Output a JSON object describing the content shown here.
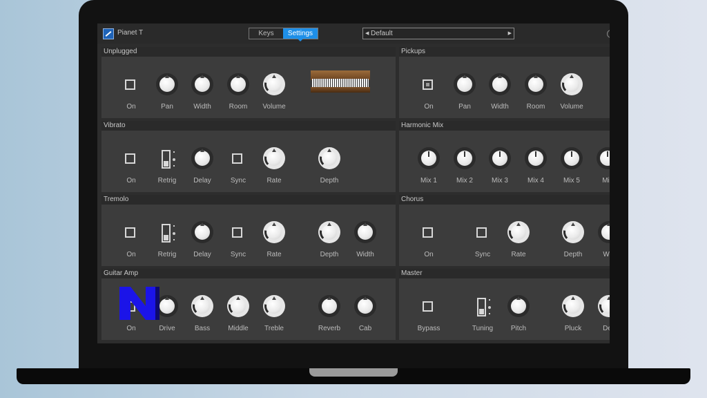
{
  "app": {
    "title": "Pianet T"
  },
  "tabs": [
    {
      "label": "Keys"
    },
    {
      "label": "Settings"
    }
  ],
  "preset": {
    "name": "Default"
  },
  "colors": {
    "accent": "#1e8fe8",
    "panel_bg": "#3c3c3c",
    "overlay_logo": "#1b14e8"
  },
  "panels": {
    "unplugged": {
      "title": "Unplugged",
      "controls": [
        {
          "type": "checkbox",
          "label": "On",
          "checked": false
        },
        {
          "type": "knob",
          "label": "Pan"
        },
        {
          "type": "knob",
          "label": "Width"
        },
        {
          "type": "knob",
          "label": "Room"
        },
        {
          "type": "knob",
          "label": "Volume"
        }
      ],
      "image": "piano-image"
    },
    "pickups": {
      "title": "Pickups",
      "controls": [
        {
          "type": "checkbox",
          "label": "On",
          "checked": true
        },
        {
          "type": "knob",
          "label": "Pan"
        },
        {
          "type": "knob",
          "label": "Width"
        },
        {
          "type": "knob",
          "label": "Room"
        },
        {
          "type": "knob",
          "label": "Volume"
        }
      ]
    },
    "vibrato": {
      "title": "Vibrato",
      "controls": [
        {
          "type": "checkbox",
          "label": "On",
          "checked": false
        },
        {
          "type": "toggle",
          "label": "Retrig"
        },
        {
          "type": "knob",
          "label": "Delay"
        },
        {
          "type": "checkbox",
          "label": "Sync",
          "checked": false
        },
        {
          "type": "knob",
          "label": "Rate"
        },
        {
          "type": "knob",
          "label": "Depth"
        }
      ]
    },
    "harmonic_mix": {
      "title": "Harmonic Mix",
      "controls": [
        {
          "type": "knob",
          "label": "Mix 1"
        },
        {
          "type": "knob",
          "label": "Mix 2"
        },
        {
          "type": "knob",
          "label": "Mix 3"
        },
        {
          "type": "knob",
          "label": "Mix 4"
        },
        {
          "type": "knob",
          "label": "Mix 5"
        },
        {
          "type": "knob",
          "label": "Mix"
        }
      ]
    },
    "tremolo": {
      "title": "Tremolo",
      "controls": [
        {
          "type": "checkbox",
          "label": "On",
          "checked": false
        },
        {
          "type": "toggle",
          "label": "Retrig"
        },
        {
          "type": "knob",
          "label": "Delay"
        },
        {
          "type": "checkbox",
          "label": "Sync",
          "checked": false
        },
        {
          "type": "knob",
          "label": "Rate"
        },
        {
          "type": "knob",
          "label": "Depth"
        },
        {
          "type": "knob",
          "label": "Width"
        }
      ]
    },
    "chorus": {
      "title": "Chorus",
      "controls": [
        {
          "type": "checkbox",
          "label": "On",
          "checked": false
        },
        {
          "type": "checkbox",
          "label": "Sync",
          "checked": false
        },
        {
          "type": "knob",
          "label": "Rate"
        },
        {
          "type": "knob",
          "label": "Depth"
        },
        {
          "type": "knob",
          "label": "Wid"
        }
      ]
    },
    "guitar_amp": {
      "title": "Guitar Amp",
      "controls": [
        {
          "type": "checkbox",
          "label": "On",
          "checked": false
        },
        {
          "type": "knob",
          "label": "Drive"
        },
        {
          "type": "knob",
          "label": "Bass"
        },
        {
          "type": "knob",
          "label": "Middle"
        },
        {
          "type": "knob",
          "label": "Treble"
        },
        {
          "type": "knob",
          "label": "Reverb"
        },
        {
          "type": "knob",
          "label": "Cab"
        }
      ]
    },
    "master": {
      "title": "Master",
      "controls": [
        {
          "type": "checkbox",
          "label": "Bypass",
          "checked": false
        },
        {
          "type": "toggle",
          "label": "Tuning"
        },
        {
          "type": "knob",
          "label": "Pitch"
        },
        {
          "type": "knob",
          "label": "Pluck"
        },
        {
          "type": "knob",
          "label": "Dec"
        }
      ]
    }
  }
}
